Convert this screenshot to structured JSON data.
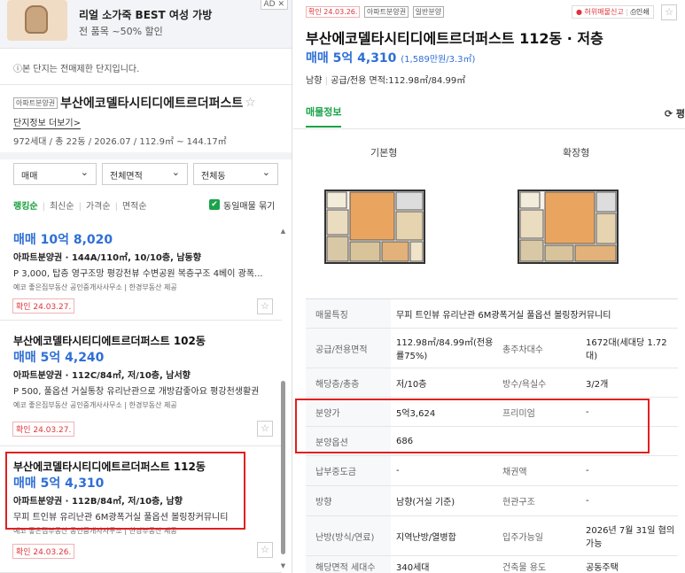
{
  "ad": {
    "title": "리얼 소가죽 BEST 여성 가방",
    "subtitle": "전 품목 ~50% 할인",
    "badge": "AD ✕"
  },
  "notice": "ⓘ본 단지는 전매제한 단지입니다.",
  "complex": {
    "tag": "아파트분양권",
    "name": "부산에코델타시티디에트르더퍼스트",
    "more_link": "단지정보 더보기>",
    "info": "972세대 / 총 22동 / 2026.07 / 112.9㎡ ~ 144.17㎡"
  },
  "filters": {
    "trade": "매매",
    "area": "전체면적",
    "building": "전체동"
  },
  "sort": {
    "options": [
      "랭킹순",
      "최신순",
      "가격순",
      "면적순"
    ],
    "same_listing_label": "동일매물 묶기",
    "check": "✔"
  },
  "listings": [
    {
      "title": "",
      "price": "매매 10억 8,020",
      "spec": "아파트분양권 · 144A/110㎡, 10/10층, 남동향",
      "desc": "P 3,000, 탑층 영구조망 평강천뷰 수변공원 복층구조 4베이 광폭...",
      "broker": "예코 좋은집부동산 공인중개사사무소 | 한경부동산 제공",
      "confirmed": "확인 24.03.27."
    },
    {
      "title": "부산에코델타시티디에트르더퍼스트 102동",
      "price": "매매 5억 4,240",
      "spec": "아파트분양권 · 112C/84㎡, 저/10층, 남서향",
      "desc": "P 500, 풀옵션 거실통창 유리난관으로 개방감좋아요 평강천생활권",
      "broker": "예코 좋은집부동산 공인중개사사무소 | 한경부동산 제공",
      "confirmed": "확인 24.03.27."
    },
    {
      "title": "부산에코델타시티디에트르더퍼스트 112동",
      "price": "매매 5억 4,310",
      "spec": "아파트분양권 · 112B/84㎡, 저/10층, 남향",
      "desc": "무피 트인뷰 유리난관 6M광폭거실 풀옵션 볼링장커뮤니티",
      "broker": "예코 좋은집부동산 공인중개사사무소 | 한경부동산 제공",
      "confirmed": "확인 24.03.26."
    }
  ],
  "detail": {
    "confirmed_tag": "확인 24.03.26.",
    "tags": [
      "아파트분양권",
      "일반분양"
    ],
    "report_label": "● 허위매물신고",
    "print_label": "⎙인쇄",
    "title": "부산에코델타시티디에트르더퍼스트 112동 · 저층",
    "price": "매매 5억 4,310",
    "price_per_unit": "(1,589만원/3.3㎡)",
    "direction": "남향",
    "area": "공급/전용 면적:112.98㎡/84.99㎡",
    "tab_active": "매물정보",
    "tab_right": "⟳ 평",
    "plans": [
      "기본형",
      "확장형"
    ],
    "rows": [
      {
        "label": "매물특징",
        "value": "무피 트인뷰 유리난관 6M광폭거실 풀옵션 볼링장커뮤니티",
        "label2": "",
        "value2": ""
      },
      {
        "label": "공급/전용면적",
        "value": "112.98㎡/84.99㎡(전용률75%)",
        "label2": "총주차대수",
        "value2": "1672대(세대당 1.72대)"
      },
      {
        "label": "해당층/총층",
        "value": "저/10층",
        "label2": "방수/욕실수",
        "value2": "3/2개"
      },
      {
        "label": "분양가",
        "value": "5억3,624",
        "label2": "프리미엄",
        "value2": "-"
      },
      {
        "label": "분양옵션",
        "value": "686",
        "label2": "",
        "value2": ""
      },
      {
        "label": "납부중도금",
        "value": "-",
        "label2": "채권액",
        "value2": "-"
      },
      {
        "label": "방향",
        "value": "남향(거실 기준)",
        "label2": "현관구조",
        "value2": "-"
      },
      {
        "label": "난방(방식/연료)",
        "value": "지역난방/열병합",
        "label2": "입주가능일",
        "value2": "2026년 7월 31일 협의가능"
      },
      {
        "label": "해당면적 세대수",
        "value": "340세대",
        "label2": "건축물 용도",
        "value2": "공동주택"
      }
    ]
  }
}
